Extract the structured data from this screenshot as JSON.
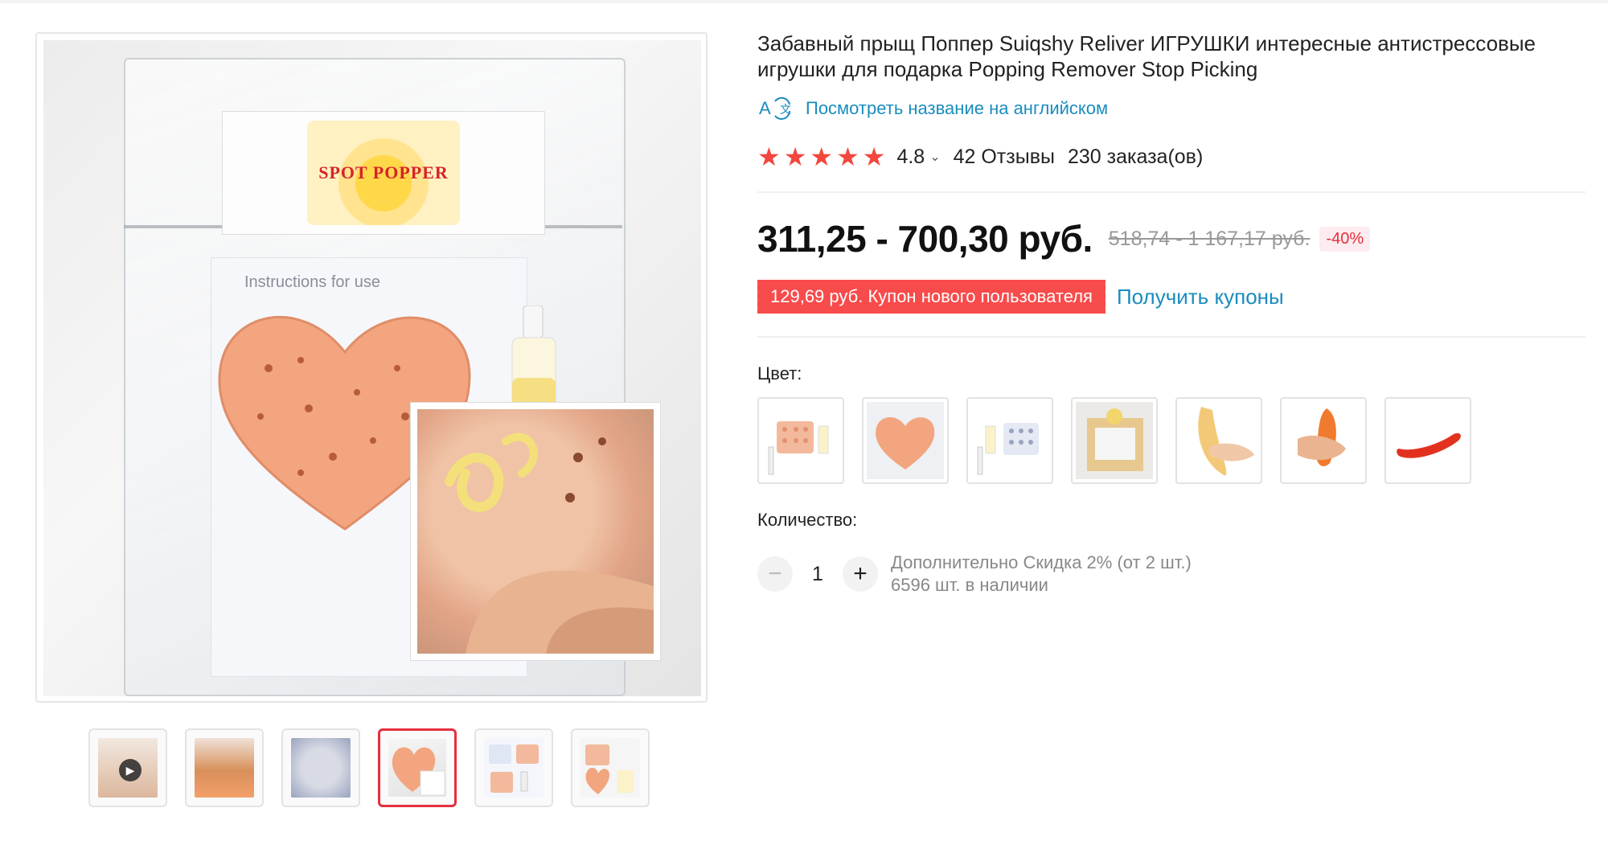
{
  "product": {
    "title": "Забавный прыщ Поппер Suiqshy Reliver ИГРУШКИ интересные антистрессовые игрушки для подарка Popping Remover Stop Picking",
    "translate_link": "Посмотреть название на английском",
    "rating": "4.8",
    "reviews": "42 Отзывы",
    "orders": "230 заказа(ов)",
    "price": "311,25 - 700,30 руб.",
    "old_price": "518,74 - 1 167,17 руб.",
    "discount": "-40%",
    "coupon": "129,69 руб. Купон нового пользователя",
    "get_coupons": "Получить купоны",
    "color_label": "Цвет:",
    "quantity_label": "Количество:",
    "quantity": "1",
    "extra_discount": "Дополнительно Скидка 2% (от 2 шт.)",
    "stock": "6596 шт. в наличии"
  },
  "gallery": {
    "label_text": "SPOT POPPER",
    "paper_text": "Instructions for use",
    "thumbnails": [
      {
        "name": "video"
      },
      {
        "name": "people"
      },
      {
        "name": "yellow-squeeze"
      },
      {
        "name": "bag",
        "active": true
      },
      {
        "name": "kit-white"
      },
      {
        "name": "kit-heart"
      }
    ]
  },
  "colors": {
    "accent": "#e62e3d",
    "link": "#1a8cbf",
    "star": "#f2473d",
    "coupon": "#f84b4b"
  },
  "icons": {
    "translate": "translate-icon",
    "stars": "star-icon",
    "chevron": "chevron-down-icon",
    "minus": "minus-icon",
    "plus": "plus-icon",
    "play": "play-icon"
  }
}
